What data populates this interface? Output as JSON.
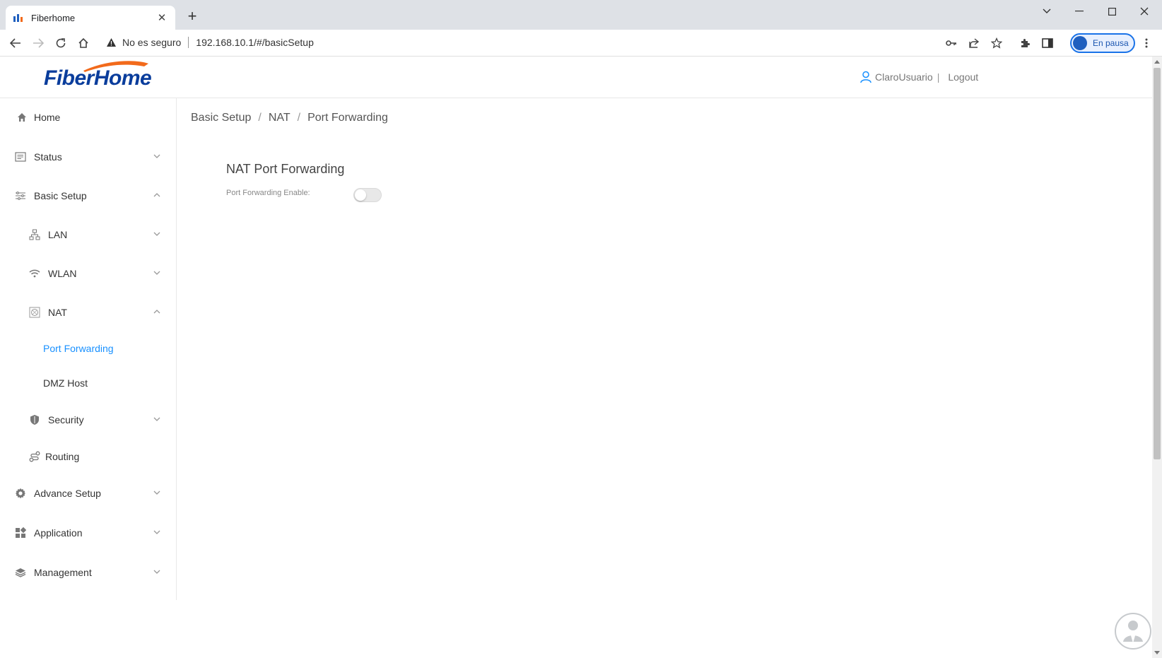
{
  "browser": {
    "tab_title": "Fiberhome",
    "security_label": "No es seguro",
    "url": "192.168.10.1/#/basicSetup",
    "profile_label": "En pausa"
  },
  "header": {
    "logo_text": "FiberHome",
    "username": "ClaroUsuario",
    "separator": "|",
    "logout": "Logout"
  },
  "sidebar": {
    "home": "Home",
    "status": "Status",
    "basic_setup": "Basic Setup",
    "lan": "LAN",
    "wlan": "WLAN",
    "nat": "NAT",
    "port_forwarding": "Port Forwarding",
    "dmz_host": "DMZ Host",
    "security": "Security",
    "routing": "Routing",
    "advance_setup": "Advance Setup",
    "application": "Application",
    "management": "Management"
  },
  "breadcrumb": {
    "level1": "Basic Setup",
    "level2": "NAT",
    "level3": "Port Forwarding",
    "sep": "/"
  },
  "main": {
    "section_title": "NAT Port Forwarding",
    "enable_label": "Port Forwarding Enable:",
    "enable_state": false
  },
  "colors": {
    "accent": "#1890ff",
    "logo_blue": "#0a3d9c",
    "logo_orange": "#f26a1b"
  }
}
